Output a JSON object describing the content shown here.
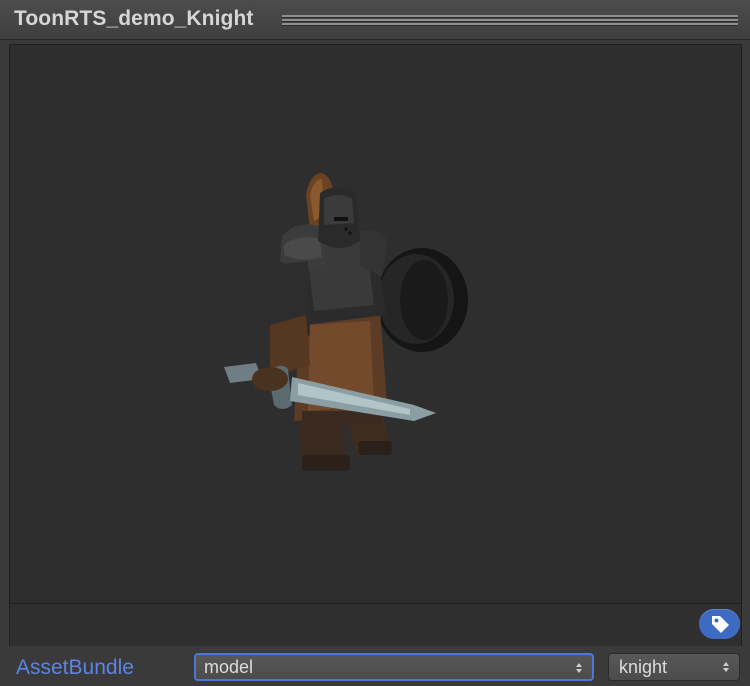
{
  "header": {
    "title": "ToonRTS_demo_Knight"
  },
  "preview": {
    "subject_icon": "knight-model",
    "background_color": "#2e2e2e"
  },
  "tag_button": {
    "icon": "tag-icon",
    "color": "#3d6bc4"
  },
  "footer": {
    "label": "AssetBundle",
    "label_color": "#5b84e6",
    "bundle_name": {
      "value": "model"
    },
    "bundle_variant": {
      "value": "knight"
    }
  }
}
